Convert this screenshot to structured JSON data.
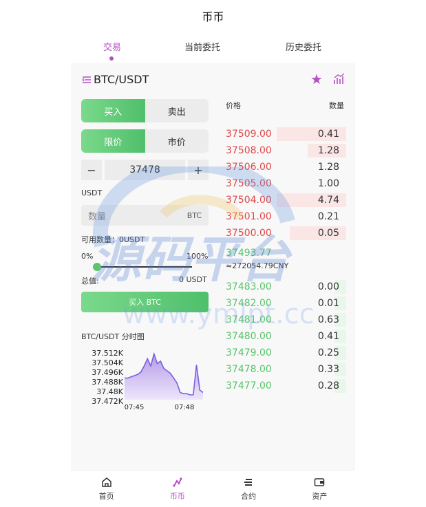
{
  "header": {
    "title": "币币"
  },
  "tabs": [
    {
      "label": "交易",
      "active": true
    },
    {
      "label": "当前委托",
      "active": false
    },
    {
      "label": "历史委托",
      "active": false
    }
  ],
  "pair": {
    "symbol": "BTC/USDT",
    "menu_icon": "list-menu-icon",
    "favorite_icon": "star-icon",
    "chart_icon": "bar-chart-icon"
  },
  "side_tabs": {
    "buy": "买入",
    "sell": "卖出",
    "selected": "buy"
  },
  "order_type": {
    "limit": "限价",
    "market": "市价",
    "selected": "limit"
  },
  "price_stepper": {
    "minus": "−",
    "value": "37478",
    "plus": "+"
  },
  "price_unit_label": "USDT",
  "quantity": {
    "placeholder": "数量",
    "unit": "BTC"
  },
  "available_label": "可用数量：0USDT",
  "slider": {
    "min_label": "0%",
    "max_label": "100%",
    "value_percent": 0
  },
  "total": {
    "label": "总值:",
    "value": "0 USDT"
  },
  "submit_label": "买入 BTC",
  "mini_chart_title": "BTC/USDT 分时图",
  "order_book": {
    "price_header": "价格",
    "qty_header": "数量",
    "asks": [
      {
        "price": "37509.00",
        "qty": "0.41",
        "depth": 0.58
      },
      {
        "price": "37508.00",
        "qty": "1.28",
        "depth": 0.32
      },
      {
        "price": "37506.00",
        "qty": "1.28",
        "depth": 0.0
      },
      {
        "price": "37505.00",
        "qty": "1.00",
        "depth": 0.0
      },
      {
        "price": "37504.00",
        "qty": "4.74",
        "depth": 0.58
      },
      {
        "price": "37501.00",
        "qty": "0.21",
        "depth": 0.0
      },
      {
        "price": "37500.00",
        "qty": "0.05",
        "depth": 0.47
      }
    ],
    "last_price": "37493.77",
    "last_cny": "≈272054.79CNY",
    "bids": [
      {
        "price": "37483.00",
        "qty": "0.00",
        "depth": 0.1
      },
      {
        "price": "37482.00",
        "qty": "0.01",
        "depth": 0.1
      },
      {
        "price": "37481.00",
        "qty": "0.63",
        "depth": 0.1
      },
      {
        "price": "37480.00",
        "qty": "0.41",
        "depth": 0.1
      },
      {
        "price": "37479.00",
        "qty": "0.25",
        "depth": 0.1
      },
      {
        "price": "37478.00",
        "qty": "0.33",
        "depth": 0.1
      },
      {
        "price": "37477.00",
        "qty": "0.28",
        "depth": 0.1
      }
    ]
  },
  "chart_data": {
    "type": "area",
    "title": "BTC/USDT 分时图",
    "y_ticks": [
      "37.512K",
      "37.504K",
      "37.496K",
      "37.488K",
      "37.48K",
      "37.472K"
    ],
    "x_ticks": [
      "07:45",
      "07:48"
    ],
    "ylim": [
      37472,
      37512
    ],
    "values": [
      37490,
      37490,
      37491,
      37492,
      37493,
      37495,
      37500,
      37506,
      37500,
      37510,
      37502,
      37504,
      37498,
      37496,
      37494,
      37490,
      37486,
      37478,
      37477,
      37477,
      37476,
      37476,
      37501,
      37480,
      37478
    ]
  },
  "watermark": {
    "text": "源码平台",
    "url_text": "www.ymlpt.cc"
  },
  "colors": {
    "accent": "#b54fc4",
    "buy_green": "#57c46a",
    "sell_red": "#e04848"
  },
  "bottom_nav": [
    {
      "label": "首页",
      "icon": "home-icon",
      "active": false
    },
    {
      "label": "币币",
      "icon": "coin-exchange-icon",
      "active": true
    },
    {
      "label": "合约",
      "icon": "contract-icon",
      "active": false
    },
    {
      "label": "资产",
      "icon": "wallet-icon",
      "active": false
    }
  ]
}
